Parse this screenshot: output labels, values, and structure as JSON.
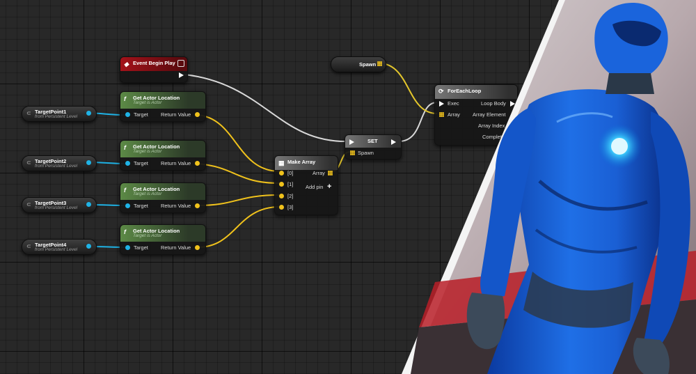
{
  "event_node": {
    "title": "Event Begin Play"
  },
  "spawn_var": {
    "name": "Spawn"
  },
  "foreach_node": {
    "title": "ForEachLoop",
    "inputs": [
      "Exec",
      "Array"
    ],
    "outputs": [
      "Loop Body",
      "Array Element",
      "Array Index",
      "Complet"
    ]
  },
  "get_location_nodes": [
    {
      "title": "Get Actor Location",
      "subtitle": "Target is Actor",
      "input": "Target",
      "output": "Return Value"
    },
    {
      "title": "Get Actor Location",
      "subtitle": "Target is Actor",
      "input": "Target",
      "output": "Return Value"
    },
    {
      "title": "Get Actor Location",
      "subtitle": "Target is Actor",
      "input": "Target",
      "output": "Return Value"
    },
    {
      "title": "Get Actor Location",
      "subtitle": "Target is Actor",
      "input": "Target",
      "output": "Return Value"
    }
  ],
  "target_points": [
    {
      "name": "TargetPoint1",
      "source": "from Persistent Level"
    },
    {
      "name": "TargetPoint2",
      "source": "from Persistent Level"
    },
    {
      "name": "TargetPoint3",
      "source": "from Persistent Level"
    },
    {
      "name": "TargetPoint4",
      "source": "from Persistent Level"
    }
  ],
  "make_array_node": {
    "title": "Make Array",
    "inputs": [
      "[0]",
      "[1]",
      "[2]",
      "[3]"
    ],
    "output": "Array",
    "add_pin": "Add pin"
  },
  "set_node": {
    "title": "SET",
    "input": "Spawn"
  },
  "colors": {
    "exec_wire": "#d9d9d9",
    "vector_wire": "#f0c21c",
    "object_wire": "#1fb3e6",
    "array_wire": "#e3c62c",
    "hero_suit": "#1565d8"
  },
  "icons": {
    "event": "diamond-event-icon",
    "function": "function-f-icon",
    "variable": "variable-link-icon",
    "loop": "loop-icon",
    "add": "plus-icon"
  }
}
